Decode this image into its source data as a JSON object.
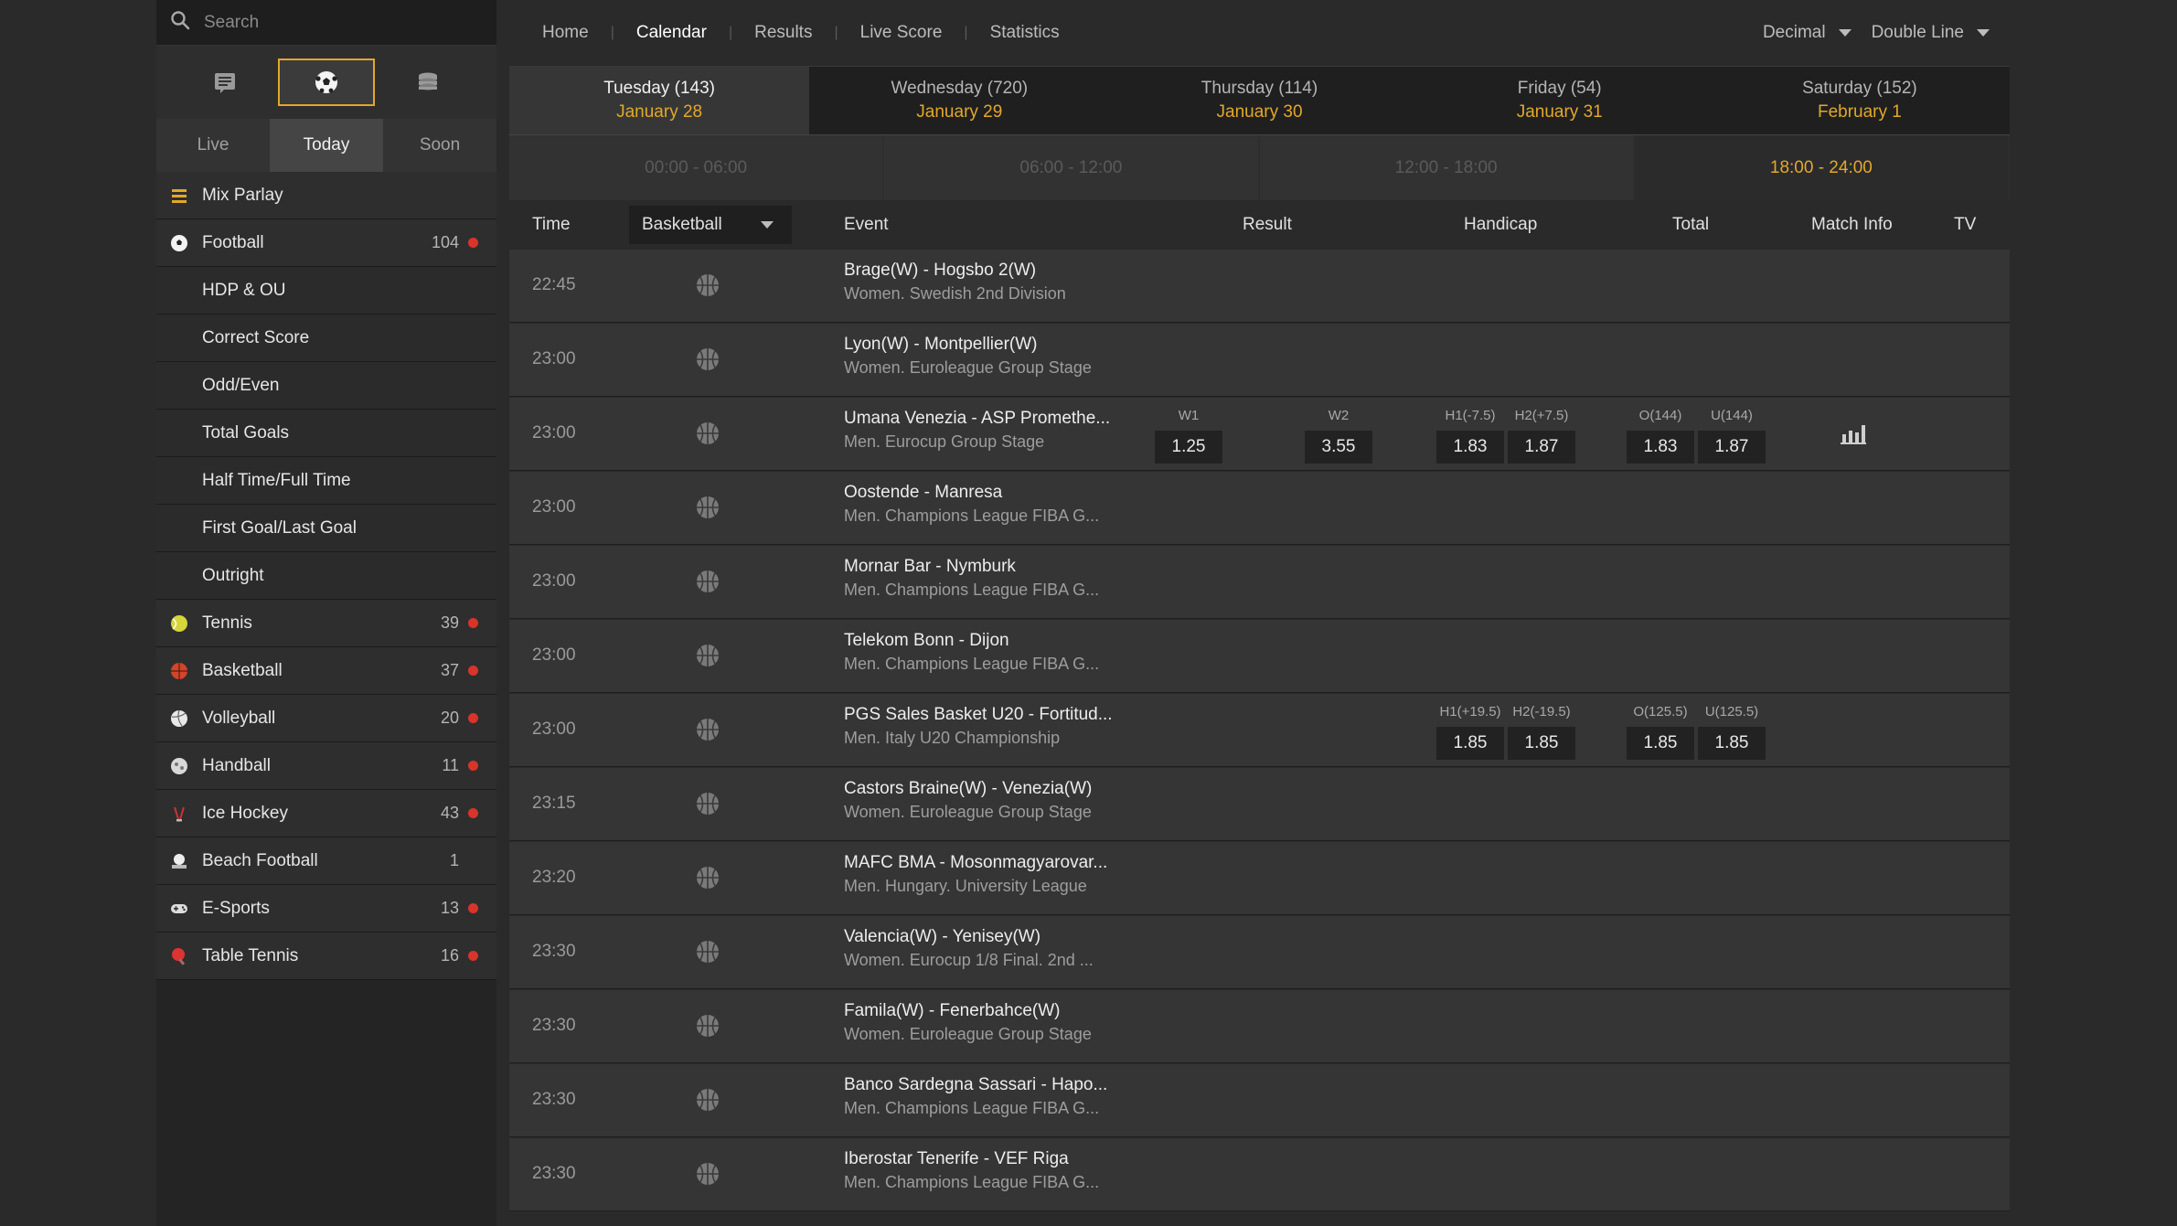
{
  "search": {
    "placeholder": "Search"
  },
  "view_icons": [
    "list-icon",
    "soccer-ball-icon",
    "coins-icon"
  ],
  "period_tabs": {
    "live": "Live",
    "today": "Today",
    "soon": "Soon"
  },
  "sports": [
    {
      "label": "Mix Parlay",
      "count": "",
      "icon": "menu-icon",
      "sub": false,
      "live": false
    },
    {
      "label": "Football",
      "count": "104",
      "icon": "soccer-icon",
      "sub": false,
      "live": true
    },
    {
      "label": "HDP & OU",
      "count": "",
      "sub": true,
      "live": false
    },
    {
      "label": "Correct Score",
      "count": "",
      "sub": true,
      "live": false
    },
    {
      "label": "Odd/Even",
      "count": "",
      "sub": true,
      "live": false
    },
    {
      "label": "Total Goals",
      "count": "",
      "sub": true,
      "live": false
    },
    {
      "label": "Half Time/Full Time",
      "count": "",
      "sub": true,
      "live": false
    },
    {
      "label": "First Goal/Last Goal",
      "count": "",
      "sub": true,
      "live": false
    },
    {
      "label": "Outright",
      "count": "",
      "sub": true,
      "live": false
    },
    {
      "label": "Tennis",
      "count": "39",
      "icon": "tennis-icon",
      "sub": false,
      "live": true
    },
    {
      "label": "Basketball",
      "count": "37",
      "icon": "basketball-icon",
      "sub": false,
      "live": true
    },
    {
      "label": "Volleyball",
      "count": "20",
      "icon": "volleyball-icon",
      "sub": false,
      "live": true
    },
    {
      "label": "Handball",
      "count": "11",
      "icon": "handball-icon",
      "sub": false,
      "live": true
    },
    {
      "label": "Ice Hockey",
      "count": "43",
      "icon": "ice-hockey-icon",
      "sub": false,
      "live": true
    },
    {
      "label": "Beach Football",
      "count": "1",
      "icon": "beach-football-icon",
      "sub": false,
      "live": false
    },
    {
      "label": "E-Sports",
      "count": "13",
      "icon": "gamepad-icon",
      "sub": false,
      "live": true
    },
    {
      "label": "Table Tennis",
      "count": "16",
      "icon": "table-tennis-icon",
      "sub": false,
      "live": true
    }
  ],
  "nav": {
    "home": "Home",
    "calendar": "Calendar",
    "results": "Results",
    "live_score": "Live Score",
    "statistics": "Statistics",
    "odds_format": "Decimal",
    "line_mode": "Double Line"
  },
  "days": [
    {
      "day": "Tuesday (143)",
      "date": "January 28"
    },
    {
      "day": "Wednesday (720)",
      "date": "January 29"
    },
    {
      "day": "Thursday (114)",
      "date": "January 30"
    },
    {
      "day": "Friday (54)",
      "date": "January 31"
    },
    {
      "day": "Saturday (152)",
      "date": "February 1"
    }
  ],
  "slots": [
    "00:00 - 06:00",
    "06:00 - 12:00",
    "12:00 - 18:00",
    "18:00 - 24:00"
  ],
  "table_head": {
    "time": "Time",
    "sport": "Basketball",
    "event": "Event",
    "result": "Result",
    "handicap": "Handicap",
    "total": "Total",
    "match_info": "Match Info",
    "tv": "TV"
  },
  "events": [
    {
      "time": "22:45",
      "teams": "Brage(W) - Hogsbo 2(W)",
      "league": "Women. Swedish 2nd Division"
    },
    {
      "time": "23:00",
      "teams": "Lyon(W) - Montpellier(W)",
      "league": "Women. Euroleague Group Stage"
    },
    {
      "time": "23:00",
      "teams": "Umana Venezia - ASP Promethe...",
      "league": "Men. Eurocup Group Stage",
      "w1_label": "W1",
      "w1": "1.25",
      "w2_label": "W2",
      "w2": "3.55",
      "h1_label": "H1(-7.5)",
      "h1": "1.83",
      "h2_label": "H2(+7.5)",
      "h2": "1.87",
      "o_label": "O(144)",
      "o": "1.83",
      "u_label": "U(144)",
      "u": "1.87"
    },
    {
      "time": "23:00",
      "teams": "Oostende - Manresa",
      "league": "Men. Champions League FIBA G..."
    },
    {
      "time": "23:00",
      "teams": "Mornar Bar - Nymburk",
      "league": "Men. Champions League FIBA G..."
    },
    {
      "time": "23:00",
      "teams": "Telekom Bonn - Dijon",
      "league": "Men. Champions League FIBA G..."
    },
    {
      "time": "23:00",
      "teams": "PGS Sales Basket U20 - Fortitud...",
      "league": "Men. Italy U20 Championship",
      "h1_label": "H1(+19.5)",
      "h1": "1.85",
      "h2_label": "H2(-19.5)",
      "h2": "1.85",
      "o_label": "O(125.5)",
      "o": "1.85",
      "u_label": "U(125.5)",
      "u": "1.85"
    },
    {
      "time": "23:15",
      "teams": "Castors Braine(W) - Venezia(W)",
      "league": "Women. Euroleague Group Stage"
    },
    {
      "time": "23:20",
      "teams": "MAFC BMA - Mosonmagyarovar...",
      "league": "Men. Hungary. University League"
    },
    {
      "time": "23:30",
      "teams": "Valencia(W) - Yenisey(W)",
      "league": "Women. Eurocup 1/8 Final. 2nd ..."
    },
    {
      "time": "23:30",
      "teams": "Famila(W) - Fenerbahce(W)",
      "league": "Women. Euroleague Group Stage"
    },
    {
      "time": "23:30",
      "teams": "Banco Sardegna Sassari - Hapo...",
      "league": "Men. Champions League FIBA G..."
    },
    {
      "time": "23:30",
      "teams": "Iberostar Tenerife - VEF Riga",
      "league": "Men. Champions League FIBA G..."
    }
  ],
  "colors": {
    "accent": "#e2a82a",
    "live_dot": "#d8342a",
    "background": "#2a2a2a"
  }
}
